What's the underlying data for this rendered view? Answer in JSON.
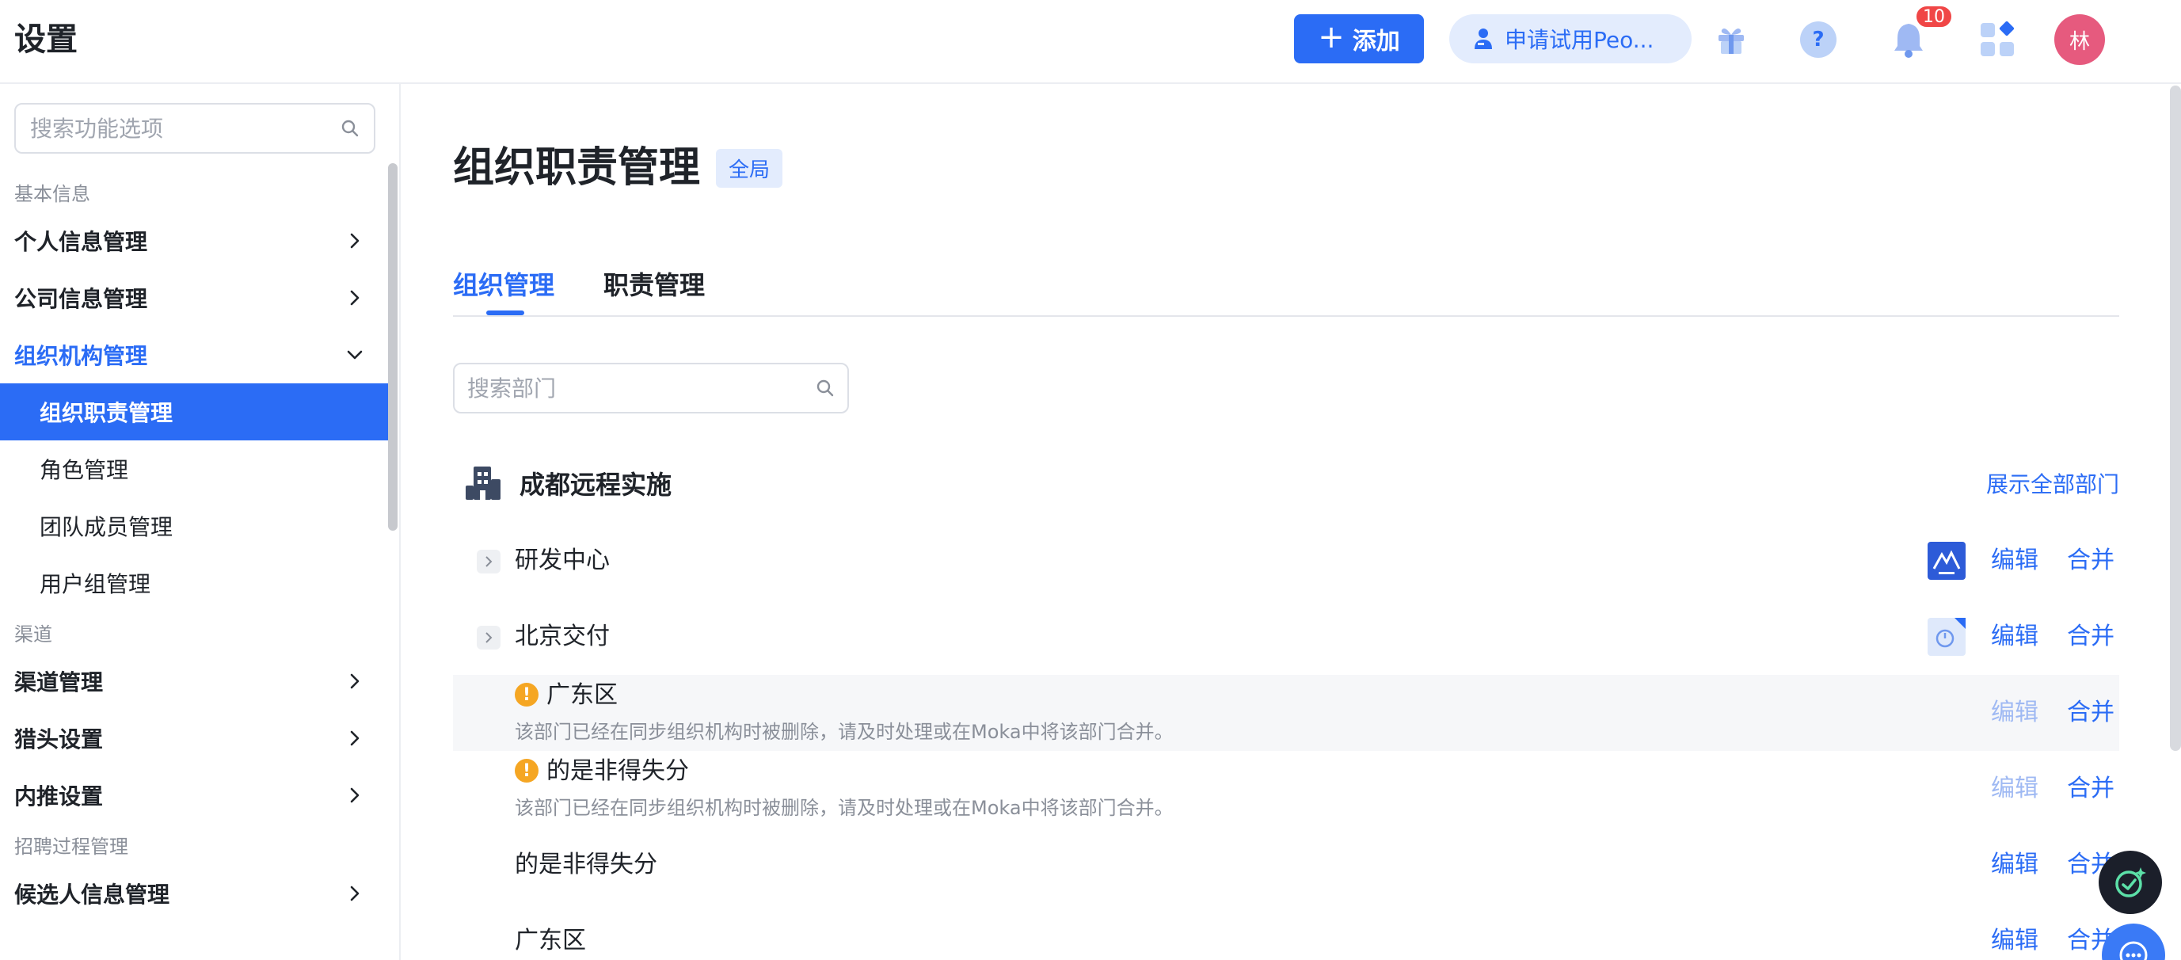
{
  "header": {
    "title": "设置",
    "add_label": "添加",
    "trial_label": "申请试用Peo...",
    "notification_count": "10",
    "avatar_text": "林"
  },
  "sidebar": {
    "search_placeholder": "搜索功能选项",
    "groups": [
      {
        "label": "基本信息",
        "items": [
          {
            "label": "个人信息管理"
          },
          {
            "label": "公司信息管理"
          },
          {
            "label": "组织机构管理",
            "expanded": true,
            "children": [
              {
                "label": "组织职责管理",
                "active": true
              },
              {
                "label": "角色管理"
              },
              {
                "label": "团队成员管理"
              },
              {
                "label": "用户组管理"
              }
            ]
          }
        ]
      },
      {
        "label": "渠道",
        "items": [
          {
            "label": "渠道管理"
          },
          {
            "label": "猎头设置"
          },
          {
            "label": "内推设置"
          }
        ]
      },
      {
        "label": "招聘过程管理",
        "items": [
          {
            "label": "候选人信息管理"
          }
        ]
      }
    ]
  },
  "main": {
    "page_title": "组织职责管理",
    "scope_badge": "全局",
    "tabs": [
      {
        "label": "组织管理",
        "active": true
      },
      {
        "label": "职责管理",
        "active": false
      }
    ],
    "dept_search_placeholder": "搜索部门",
    "org": {
      "name": "成都远程实施",
      "show_all_label": "展示全部部门"
    },
    "departments": [
      {
        "name": "研发中心",
        "expandable": true,
        "logo": "blue-mountain-logo",
        "edit_label": "编辑",
        "merge_label": "合并"
      },
      {
        "name": "北京交付",
        "expandable": true,
        "logo": "light-blue-logo",
        "edit_label": "编辑",
        "merge_label": "合并"
      },
      {
        "name": "广东区",
        "warning": true,
        "warning_text": "该部门已经在同步组织机构时被删除，请及时处理或在Moka中将该部门合并。",
        "edit_label": "编辑",
        "merge_label": "合并"
      },
      {
        "name": "的是非得失分",
        "warning": true,
        "warning_text": "该部门已经在同步组织机构时被删除，请及时处理或在Moka中将该部门合并。",
        "edit_label": "编辑",
        "merge_label": "合并"
      },
      {
        "name": "的是非得失分",
        "edit_label": "编辑",
        "merge_label": "合并"
      },
      {
        "name": "广东区",
        "edit_label": "编辑",
        "merge_label": "合并"
      }
    ]
  },
  "colors": {
    "accent": "#2b6cf5",
    "warning": "#f5a623",
    "badge_red": "#f04646",
    "avatar_bg": "#e65a7e"
  }
}
